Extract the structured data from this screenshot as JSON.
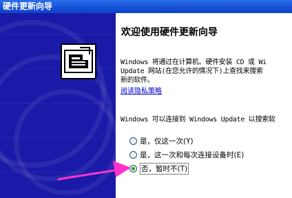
{
  "window": {
    "title": "硬件更新向导"
  },
  "wizard": {
    "heading": "欢迎使用硬件更新向导",
    "intro_lines": [
      "Windows 将通过在计算机、硬件安装 CD 或 Wi",
      "Update 网站(在您允许的情况下)上查找来搜索",
      "新的软件。"
    ],
    "privacy_link": "阅读隐私策略",
    "question": "Windows 可以连接到 Windows Update 以搜索软",
    "options": [
      {
        "label": "是，仅这一次(Y)",
        "selected": false
      },
      {
        "label": "是，这一次和每次连接设备时(E)",
        "selected": false
      },
      {
        "label": "否，暂时不(T)",
        "selected": true
      }
    ]
  },
  "colors": {
    "side_panel": "#1a1aa8",
    "title_bar": "#1652d8",
    "arrow": "#ff33cc",
    "link": "#0000cc"
  },
  "icons": {
    "wizard": "hardware-install-icon",
    "annotation": "pink-arrow-icon"
  }
}
